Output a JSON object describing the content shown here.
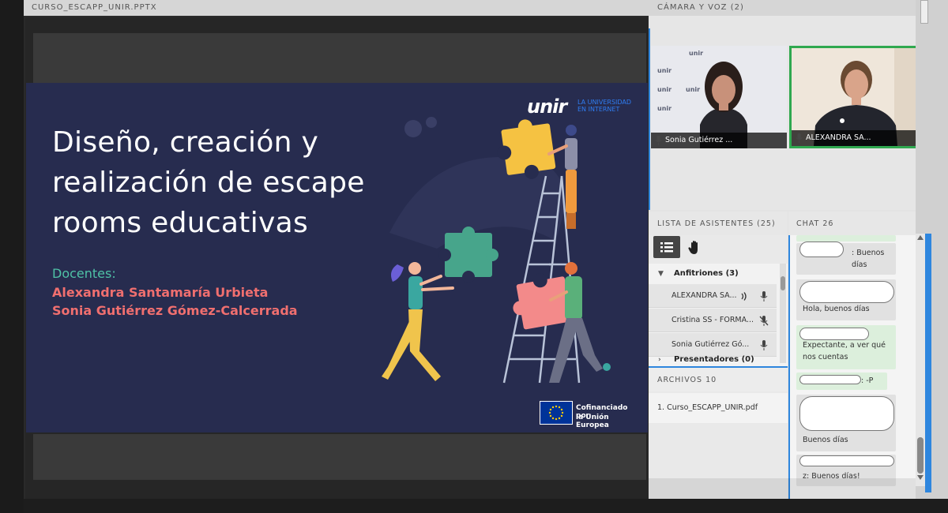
{
  "share_pod": {
    "title": "CURSO_ESCAPP_UNIR.PPTX",
    "slide": {
      "title": "Diseño, creación y realización de escape rooms educativas",
      "teachers_label": "Docentes:",
      "teachers": [
        "Alexandra Santamaría Urbieta",
        "Sonia Gutiérrez Gómez-Calcerrada"
      ],
      "logo_mark": "unir",
      "logo_tagline": "LA UNIVERSIDAD EN INTERNET",
      "eu_line_1": "Cofinanciado por",
      "eu_line_2": "la Unión Europea"
    }
  },
  "camera_pod": {
    "title": "CÁMARA Y VOZ (2)",
    "videos": [
      {
        "name": "Sonia Gutiérrez ..."
      },
      {
        "name": "ALEXANDRA SA..."
      }
    ]
  },
  "attendees_pod": {
    "title": "LISTA DE ASISTENTES  (25)",
    "hosts_label": "Anfitriones (3)",
    "attendees": [
      {
        "name": "ALEXANDRA SA...",
        "icon": "mic-speaking-icon"
      },
      {
        "name": "Cristina SS - FORMA...",
        "icon": "mic-muted-icon"
      },
      {
        "name": "Sonia Gutiérrez Gó...",
        "icon": "mic-icon"
      }
    ],
    "presenters_label": "Presentadores (0)"
  },
  "files_pod": {
    "title": "ARCHIVOS 10",
    "files": [
      "1. Curso_ESCAPP_UNIR.pdf"
    ]
  },
  "chat_pod": {
    "title": "CHAT 26",
    "messages": [
      {
        "text": ": Buenos días"
      },
      {
        "text": "Hola, buenos días"
      },
      {
        "text": "Expectante, a ver qué nos cuentas"
      },
      {
        "text": ": -P"
      },
      {
        "text": "Buenos días"
      },
      {
        "text": "z: Buenos días!"
      }
    ]
  },
  "colors": {
    "slide_bg": "#272c4f",
    "accent_blue": "#2e86de",
    "active_speaker": "#2fa84f",
    "teacher_names": "#f06f6f",
    "teachers_label": "#4fc2a6"
  }
}
